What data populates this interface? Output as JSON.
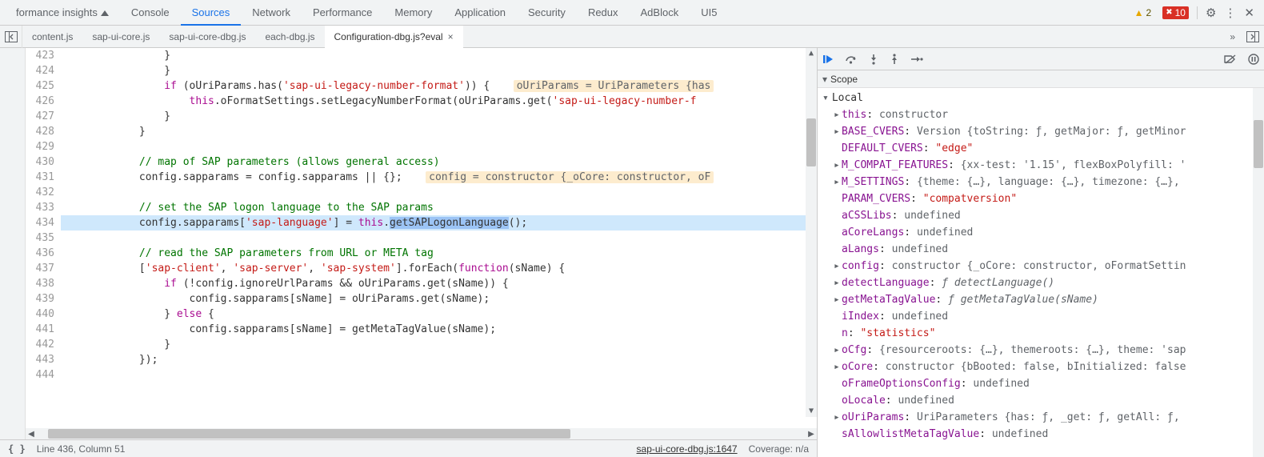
{
  "toolbar": {
    "tabs": [
      "formance insights",
      "Console",
      "Sources",
      "Network",
      "Performance",
      "Memory",
      "Application",
      "Security",
      "Redux",
      "AdBlock",
      "UI5"
    ],
    "active_index": 2,
    "warnings": "2",
    "errors": "10"
  },
  "filebar": {
    "tabs": [
      "content.js",
      "sap-ui-core.js",
      "sap-ui-core-dbg.js",
      "each-dbg.js",
      "Configuration-dbg.js?eval"
    ],
    "active_index": 4,
    "overflow": "»"
  },
  "debugger_icons": [
    "resume",
    "step-over",
    "step-into",
    "step-out",
    "step",
    "deactivate-breakpoints",
    "pause-exceptions"
  ],
  "editor": {
    "first_line": 423,
    "last_line": 444,
    "highlight_line": 434,
    "hint_424": "oUriParams = UriParameters {has",
    "hint_430": "config = constructor {_oCore: constructor, oF"
  },
  "status": {
    "position": "Line 436, Column 51",
    "link": "sap-ui-core-dbg.js:1647",
    "coverage": "Coverage: n/a"
  },
  "scope": {
    "header": "Scope",
    "local_label": "Local",
    "rows": [
      {
        "lvl": 1,
        "arrow": "▸",
        "name": "this",
        "sep": ": ",
        "val": "constructor",
        "cls": "prop-val"
      },
      {
        "lvl": 1,
        "arrow": "▸",
        "name": "BASE_CVERS",
        "sep": ": ",
        "val": "Version {toString: ƒ, getMajor: ƒ, getMinor",
        "cls": "prop-val"
      },
      {
        "lvl": 1,
        "arrow": "",
        "name": "DEFAULT_CVERS",
        "sep": ": ",
        "val": "\"edge\"",
        "cls": "prop-str"
      },
      {
        "lvl": 1,
        "arrow": "▸",
        "name": "M_COMPAT_FEATURES",
        "sep": ": ",
        "val": "{xx-test: '1.15', flexBoxPolyfill: '",
        "cls": "prop-val"
      },
      {
        "lvl": 1,
        "arrow": "▸",
        "name": "M_SETTINGS",
        "sep": ": ",
        "val": "{theme: {…}, language: {…}, timezone: {…},",
        "cls": "prop-val"
      },
      {
        "lvl": 1,
        "arrow": "",
        "name": "PARAM_CVERS",
        "sep": ": ",
        "val": "\"compatversion\"",
        "cls": "prop-str"
      },
      {
        "lvl": 1,
        "arrow": "",
        "name": "aCSSLibs",
        "sep": ": ",
        "val": "undefined",
        "cls": "prop-val"
      },
      {
        "lvl": 1,
        "arrow": "",
        "name": "aCoreLangs",
        "sep": ": ",
        "val": "undefined",
        "cls": "prop-val"
      },
      {
        "lvl": 1,
        "arrow": "",
        "name": "aLangs",
        "sep": ": ",
        "val": "undefined",
        "cls": "prop-val"
      },
      {
        "lvl": 1,
        "arrow": "▸",
        "name": "config",
        "sep": ": ",
        "val": "constructor {_oCore: constructor, oFormatSettin",
        "cls": "prop-val"
      },
      {
        "lvl": 1,
        "arrow": "▸",
        "name": "detectLanguage",
        "sep": ": ",
        "val": "ƒ detectLanguage()",
        "cls": "prop-fn"
      },
      {
        "lvl": 1,
        "arrow": "▸",
        "name": "getMetaTagValue",
        "sep": ": ",
        "val": "ƒ getMetaTagValue(sName)",
        "cls": "prop-fn"
      },
      {
        "lvl": 1,
        "arrow": "",
        "name": "iIndex",
        "sep": ": ",
        "val": "undefined",
        "cls": "prop-val"
      },
      {
        "lvl": 1,
        "arrow": "",
        "name": "n",
        "sep": ": ",
        "val": "\"statistics\"",
        "cls": "prop-str"
      },
      {
        "lvl": 1,
        "arrow": "▸",
        "name": "oCfg",
        "sep": ": ",
        "val": "{resourceroots: {…}, themeroots: {…}, theme: 'sap",
        "cls": "prop-val"
      },
      {
        "lvl": 1,
        "arrow": "▸",
        "name": "oCore",
        "sep": ": ",
        "val": "constructor {bBooted: false, bInitialized: false",
        "cls": "prop-val"
      },
      {
        "lvl": 1,
        "arrow": "",
        "name": "oFrameOptionsConfig",
        "sep": ": ",
        "val": "undefined",
        "cls": "prop-val"
      },
      {
        "lvl": 1,
        "arrow": "",
        "name": "oLocale",
        "sep": ": ",
        "val": "undefined",
        "cls": "prop-val"
      },
      {
        "lvl": 1,
        "arrow": "▸",
        "name": "oUriParams",
        "sep": ": ",
        "val": "UriParameters {has: ƒ, _get: ƒ, getAll: ƒ,",
        "cls": "prop-val"
      },
      {
        "lvl": 1,
        "arrow": "",
        "name": "sAllowlistMetaTagValue",
        "sep": ": ",
        "val": "undefined",
        "cls": "prop-val"
      }
    ]
  }
}
